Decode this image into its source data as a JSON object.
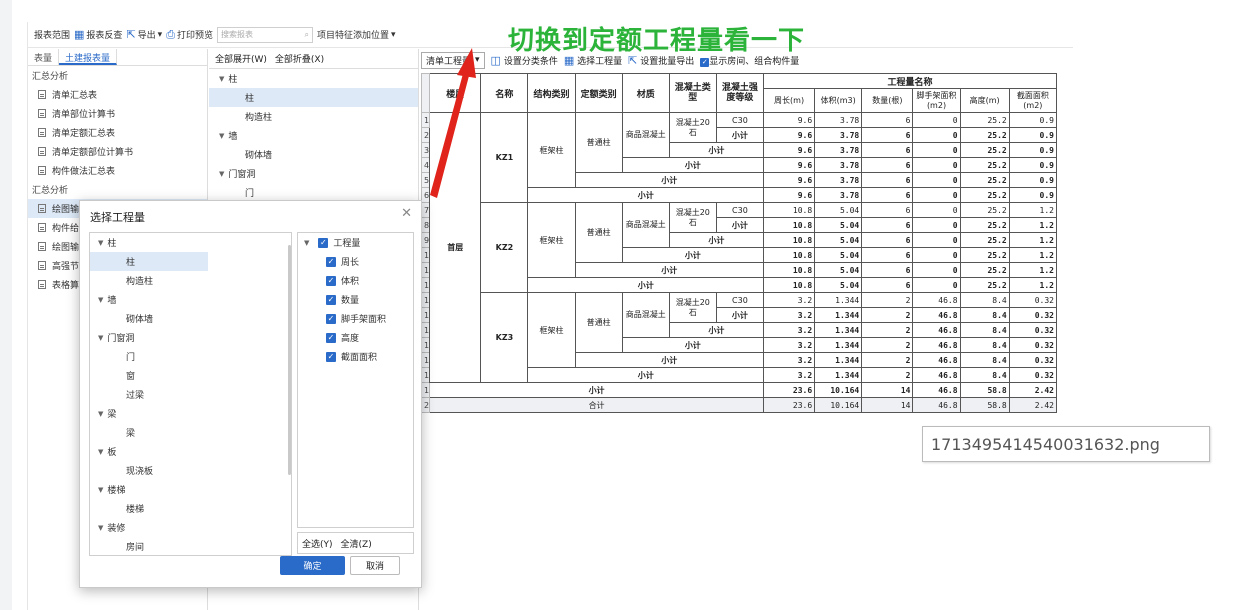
{
  "toolbar": {
    "items": [
      {
        "label": "报表范围",
        "icon": "report-range-icon"
      },
      {
        "label": "报表反查",
        "icon": "grid-icon"
      },
      {
        "label": "导出",
        "icon": "export-icon"
      },
      {
        "label": "打印预览",
        "icon": "print-icon"
      }
    ],
    "search_placeholder": "搜索报表",
    "feature_label": "项目特征添加位置"
  },
  "left_panel": {
    "tabs": [
      "表量",
      "土建报表量"
    ],
    "groups": [
      {
        "title": "汇总分析",
        "items": [
          "清单汇总表",
          "清单部位计算书",
          "清单定额汇总表",
          "清单定额部位计算书",
          "构件做法汇总表"
        ]
      },
      {
        "title": "汇总分析",
        "items": [
          "绘图输",
          "构件给",
          "绘图输",
          "高强节",
          "表格算"
        ]
      }
    ]
  },
  "middle_panel": {
    "expand_all": "全部展开(W)",
    "collapse_all": "全部折叠(X)",
    "tree": [
      {
        "label": "柱",
        "level": 0
      },
      {
        "label": "柱",
        "level": 1,
        "selected": true
      },
      {
        "label": "构造柱",
        "level": 1
      },
      {
        "label": "墙",
        "level": 0
      },
      {
        "label": "砌体墙",
        "level": 1
      },
      {
        "label": "门窗洞",
        "level": 0
      },
      {
        "label": "门",
        "level": 1
      }
    ]
  },
  "report_toolbar": {
    "combo": "清单工程量",
    "actions": [
      "设置分类条件",
      "选择工程量",
      "设置批量导出"
    ],
    "checkbox_label": "显示房间、组合构件量"
  },
  "annotation": "切换到定额工程量看一下",
  "filename": "1713495414540031632.png",
  "table": {
    "headers": {
      "floor": "楼层",
      "name": "名称",
      "struct": "结构类别",
      "quota": "定额类别",
      "material": "材质",
      "conc_type": "混凝土类型",
      "grade": "混凝土强度等级",
      "group": "工程量名称",
      "metrics": [
        "周长(m)",
        "体积(m3)",
        "数量(根)",
        "脚手架面积(m2)",
        "高度(m)",
        "截面面积(m2)"
      ]
    },
    "floor": "首层",
    "struct": "框架柱",
    "quota": "普通柱",
    "material": "商品混凝土",
    "conc_type": "混凝土20石",
    "grade": "C30",
    "subtotal": "小计",
    "total": "合计",
    "components": [
      {
        "name": "KZ1",
        "rows": [
          [
            "9.6",
            "3.78",
            "6",
            "0",
            "25.2",
            "0.9"
          ],
          [
            "9.6",
            "3.78",
            "6",
            "0",
            "25.2",
            "0.9"
          ],
          [
            "9.6",
            "3.78",
            "6",
            "0",
            "25.2",
            "0.9"
          ],
          [
            "9.6",
            "3.78",
            "6",
            "0",
            "25.2",
            "0.9"
          ],
          [
            "9.6",
            "3.78",
            "6",
            "0",
            "25.2",
            "0.9"
          ],
          [
            "9.6",
            "3.78",
            "6",
            "0",
            "25.2",
            "0.9"
          ]
        ]
      },
      {
        "name": "KZ2",
        "rows": [
          [
            "10.8",
            "5.04",
            "6",
            "0",
            "25.2",
            "1.2"
          ],
          [
            "10.8",
            "5.04",
            "6",
            "0",
            "25.2",
            "1.2"
          ],
          [
            "10.8",
            "5.04",
            "6",
            "0",
            "25.2",
            "1.2"
          ],
          [
            "10.8",
            "5.04",
            "6",
            "0",
            "25.2",
            "1.2"
          ],
          [
            "10.8",
            "5.04",
            "6",
            "0",
            "25.2",
            "1.2"
          ],
          [
            "10.8",
            "5.04",
            "6",
            "0",
            "25.2",
            "1.2"
          ]
        ]
      },
      {
        "name": "KZ3",
        "rows": [
          [
            "3.2",
            "1.344",
            "2",
            "46.8",
            "8.4",
            "0.32"
          ],
          [
            "3.2",
            "1.344",
            "2",
            "46.8",
            "8.4",
            "0.32"
          ],
          [
            "3.2",
            "1.344",
            "2",
            "46.8",
            "8.4",
            "0.32"
          ],
          [
            "3.2",
            "1.344",
            "2",
            "46.8",
            "8.4",
            "0.32"
          ],
          [
            "3.2",
            "1.344",
            "2",
            "46.8",
            "8.4",
            "0.32"
          ],
          [
            "3.2",
            "1.344",
            "2",
            "46.8",
            "8.4",
            "0.32"
          ]
        ]
      }
    ],
    "floor_subtotal": [
      "23.6",
      "10.164",
      "14",
      "46.8",
      "58.8",
      "2.42"
    ],
    "grand_total": [
      "23.6",
      "10.164",
      "14",
      "46.8",
      "58.8",
      "2.42"
    ]
  },
  "dialog": {
    "title": "选择工程量",
    "tree": [
      {
        "label": "柱",
        "level": 0
      },
      {
        "label": "柱",
        "level": 1,
        "selected": true
      },
      {
        "label": "构造柱",
        "level": 1
      },
      {
        "label": "墙",
        "level": 0
      },
      {
        "label": "砌体墙",
        "level": 1
      },
      {
        "label": "门窗洞",
        "level": 0
      },
      {
        "label": "门",
        "level": 1
      },
      {
        "label": "窗",
        "level": 1
      },
      {
        "label": "过梁",
        "level": 1
      },
      {
        "label": "梁",
        "level": 0
      },
      {
        "label": "梁",
        "level": 1
      },
      {
        "label": "板",
        "level": 0
      },
      {
        "label": "现浇板",
        "level": 1
      },
      {
        "label": "楼梯",
        "level": 0
      },
      {
        "label": "楼梯",
        "level": 1
      },
      {
        "label": "装修",
        "level": 0
      },
      {
        "label": "房间",
        "level": 1
      }
    ],
    "checks_root": "工程量",
    "checks": [
      "周长",
      "体积",
      "数量",
      "脚手架面积",
      "高度",
      "截面面积"
    ],
    "select_all": "全选(Y)",
    "clear_all": "全清(Z)",
    "ok": "确定",
    "cancel": "取消"
  },
  "colors": {
    "accent": "#2a6ac8",
    "annotation": "#2bb33a",
    "arrow": "#e0241b"
  }
}
